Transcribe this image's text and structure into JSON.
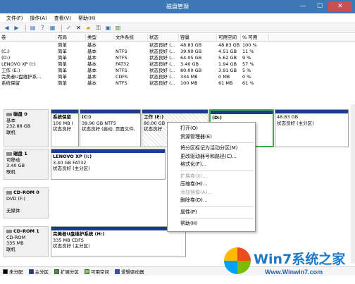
{
  "window": {
    "title": "磁盘管理",
    "minimize": "—",
    "maximize": "☐",
    "close": "✕"
  },
  "menu": [
    "文件(F)",
    "操作(A)",
    "查看(V)",
    "帮助(H)"
  ],
  "volume_table": {
    "headers": [
      "卷",
      "布局",
      "类型",
      "文件系统",
      "状态",
      "容量",
      "可用空间",
      "% 可用"
    ],
    "rows": [
      [
        "",
        "简单",
        "基本",
        "",
        "状态良好 (...",
        "48.83 GB",
        "48.83 GB",
        "100 %"
      ],
      [
        "(C:)",
        "简单",
        "基本",
        "NTFS",
        "状态良好 (...",
        "39.90 GB",
        "4.51 GB",
        "11 %"
      ],
      [
        "(D:)",
        "简单",
        "基本",
        "NTFS",
        "状态良好 (...",
        "64.05 GB",
        "5.62 GB",
        "9 %"
      ],
      [
        "LENOVO XP (I:)",
        "简单",
        "基本",
        "FAT32",
        "状态良好 (...",
        "3.40 GB",
        "1.94 GB",
        "57 %"
      ],
      [
        "工作 (E:)",
        "简单",
        "基本",
        "NTFS",
        "状态良好 (...",
        "80.00 GB",
        "3.91 GB",
        "5 %"
      ],
      [
        "完美者U盘维护系...",
        "简单",
        "基本",
        "CDFS",
        "状态良好 (...",
        "334 MB",
        "0 MB",
        "0 %"
      ],
      [
        "系统保留",
        "简单",
        "基本",
        "NTFS",
        "状态良好 (...",
        "100 MB",
        "61 MB",
        "61 %"
      ]
    ]
  },
  "disks": [
    {
      "name": "磁盘 0",
      "type": "基本",
      "size": "232.88 GB",
      "status": "联机",
      "partitions": [
        {
          "name": "系统保留",
          "line1": "100 MB I",
          "line2": "状态良好"
        },
        {
          "name": "(C:)",
          "line1": "39.90 GB NTFS",
          "line2": "状态良好 (启动, 页面文件,"
        },
        {
          "name": "工作 (E:)",
          "line1": "80.00 GB",
          "line2": "状态良好"
        },
        {
          "name": "(D:)",
          "line1": "",
          "line2": ""
        },
        {
          "name": "",
          "line1": "48.83 GB",
          "line2": "状态良好 (主分区)"
        }
      ]
    },
    {
      "name": "磁盘 1",
      "type": "可移动",
      "size": "3.40 GB",
      "status": "联机",
      "partitions": [
        {
          "name": "LENOVO XP (I:)",
          "line1": "3.40 GB FAT32",
          "line2": "状态良好 (主分区)"
        }
      ]
    },
    {
      "name": "CD-ROM 0",
      "type": "DVD (F:)",
      "size": "",
      "status": "无媒体",
      "partitions": []
    },
    {
      "name": "CD-ROM 1",
      "type": "CD-ROM",
      "size": "335 MB",
      "status": "联机",
      "partitions": [
        {
          "name": "完美者U盘维护系统 (H:)",
          "line1": "335 MB CDFS",
          "line2": "状态良好 (主分区)"
        }
      ]
    }
  ],
  "context_menu": {
    "items": [
      {
        "label": "打开(O)",
        "enabled": true
      },
      {
        "label": "资源管理器(E)",
        "enabled": true
      },
      {
        "sep": true
      },
      {
        "label": "将分区标记为活动分区(M)",
        "enabled": true
      },
      {
        "label": "更改驱动器号和路径(C)...",
        "enabled": true
      },
      {
        "label": "格式化(F)...",
        "enabled": true
      },
      {
        "sep": true
      },
      {
        "label": "扩展卷(X)...",
        "enabled": false
      },
      {
        "label": "压缩卷(H)...",
        "enabled": true
      },
      {
        "label": "添加镜像(A)...",
        "enabled": false
      },
      {
        "label": "删除卷(D)...",
        "enabled": true
      },
      {
        "sep": true
      },
      {
        "label": "属性(P)",
        "enabled": true
      },
      {
        "sep": true
      },
      {
        "label": "帮助(H)",
        "enabled": true
      }
    ]
  },
  "legend": [
    {
      "label": "未分配",
      "color": "#000000"
    },
    {
      "label": "主分区",
      "color": "#1a3c8c"
    },
    {
      "label": "扩展分区",
      "color": "#3a9a3a"
    },
    {
      "label": "可用空间",
      "color": "#7ccd4c"
    },
    {
      "label": "逻辑驱动器",
      "color": "#2850c8"
    }
  ],
  "watermark": {
    "brand": "Win7系统之家",
    "url": "Www.Winwin7.com"
  }
}
